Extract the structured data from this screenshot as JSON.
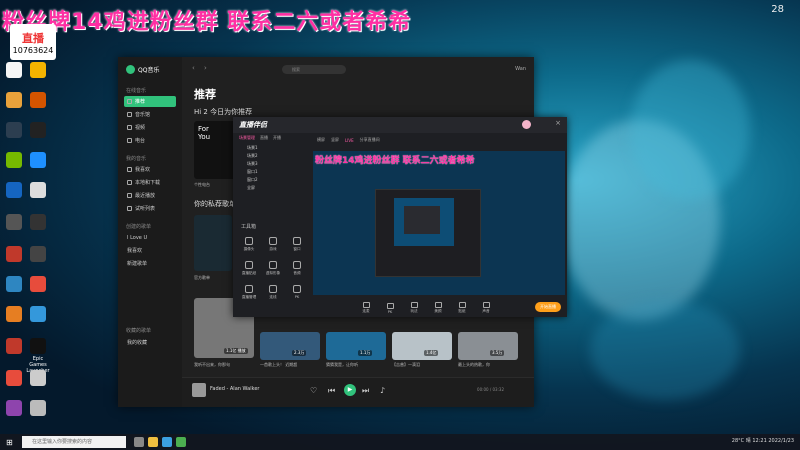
{
  "overlay": {
    "text": "粉丝牌14鸡进粉丝群 联系二六或者希希",
    "logo_label": "直播",
    "room_id": "10763624",
    "corner": "28"
  },
  "desktop_icons": [
    "",
    "",
    "",
    "",
    "",
    "",
    "",
    "",
    "",
    "",
    "",
    "",
    "",
    "",
    "",
    "",
    "",
    "",
    "",
    "",
    "",
    "",
    "",
    "",
    "Epic Games Launcher",
    "",
    "",
    ""
  ],
  "qq": {
    "brand": "QQ音乐",
    "search_placeholder": "搜索",
    "user": "Wan",
    "nav_section_online": "在线音乐",
    "nav": [
      "推荐",
      "音乐馆",
      "视频",
      "电台"
    ],
    "nav_section_mine": "我的音乐",
    "nav_mine": [
      "我喜欢",
      "本地和下载",
      "最近播放",
      "试听列表"
    ],
    "nav_section_created": "创建的歌单",
    "nav_created": [
      "I Love U",
      "我喜欢",
      "新建歌单"
    ],
    "nav_section_collect": "收藏的歌单",
    "nav_collect": [
      "我的收藏"
    ],
    "heading": "推荐",
    "daily_title": "Hi 2 今日为你推荐",
    "cover1_text": "For You",
    "cover1_caption": "个性电台",
    "private_title": "你的私荐歌单",
    "cover2_caption": "官方歌单",
    "mv_captions": [
      "我听不出来，你那句",
      "一首歌上头！ 近期超",
      "猜猜我是，让你听",
      "【吉普】一滴泪",
      "最上头的热歌，你"
    ],
    "mv_tags": [
      "1.1亿 播放",
      "2.3万",
      "1.1万",
      "1.4亿",
      "3.5万"
    ],
    "player": {
      "song": "Faded - Alan Walker",
      "time": "00:00 / 03:32"
    }
  },
  "app": {
    "logo": "直播伴侣",
    "tabs": [
      "场景管理",
      "直播",
      "开播"
    ],
    "scenes": [
      "场景1",
      "场景2",
      "场景3",
      "窗口1",
      "窗口2",
      "全屏"
    ],
    "subbar": [
      "横屏",
      "竖屏",
      "LIVE",
      "分享直播间"
    ],
    "tools_title": "工具箱",
    "tools": [
      "摄像头",
      "游戏",
      "窗口",
      "直播贴纸",
      "虚拟形象",
      "音频",
      "直播管理",
      "连线",
      "PK"
    ],
    "preview_overlay": "粉丝牌14鸡进粉丝群 联系二六或者希希",
    "bottom_items": [
      "连麦",
      "PK",
      "玩法",
      "美颜",
      "贴纸",
      "声音"
    ],
    "start_button": "开始直播"
  },
  "taskbar": {
    "search_placeholder": "在这里输入你要搜索的内容",
    "tray": "28°C 晴",
    "clock": "12:21",
    "date": "2022/1/23"
  }
}
